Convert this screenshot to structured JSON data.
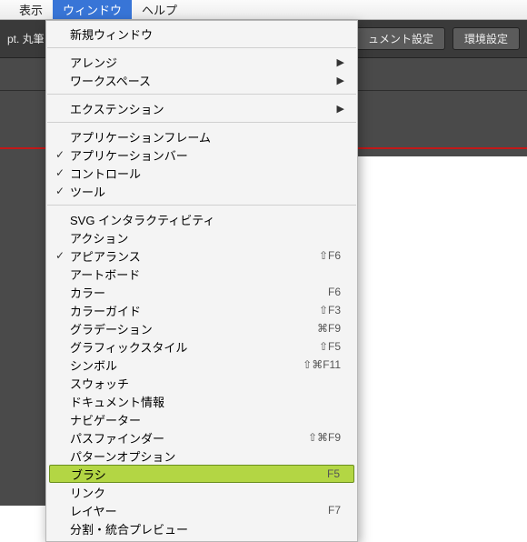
{
  "menubar": {
    "items": [
      "表示",
      "ウィンドウ",
      "ヘルプ"
    ],
    "activeIndex": 1
  },
  "toolbar": {
    "brushPrefix": "pt. 丸筆",
    "docSettings": "ュメント設定",
    "prefs": "環境設定"
  },
  "menu": {
    "newWindow": "新規ウィンドウ",
    "arrange": "アレンジ",
    "workspace": "ワークスペース",
    "extension": "エクステンション",
    "appFrame": "アプリケーションフレーム",
    "appBar": "アプリケーションバー",
    "control": "コントロール",
    "tools": "ツール",
    "svgInteract": "SVG インタラクティビティ",
    "actions": "アクション",
    "appearance": "アピアランス",
    "artboards": "アートボード",
    "color": "カラー",
    "colorGuide": "カラーガイド",
    "gradient": "グラデーション",
    "graphicStyle": "グラフィックスタイル",
    "symbols": "シンボル",
    "swatches": "スウォッチ",
    "docInfo": "ドキュメント情報",
    "navigator": "ナビゲーター",
    "pathfinder": "パスファインダー",
    "patternOpts": "パターンオプション",
    "brushes": "ブラシ",
    "links": "リンク",
    "layers": "レイヤー",
    "sepPreview": "分割・統合プレビュー"
  },
  "shortcuts": {
    "appearance": "⇧F6",
    "color": "F6",
    "colorGuide": "⇧F3",
    "gradient": "⌘F9",
    "graphicStyle": "⇧F5",
    "symbols": "⇧⌘F11",
    "pathfinder": "⇧⌘F9",
    "brushes": "F5",
    "layers": "F7"
  }
}
